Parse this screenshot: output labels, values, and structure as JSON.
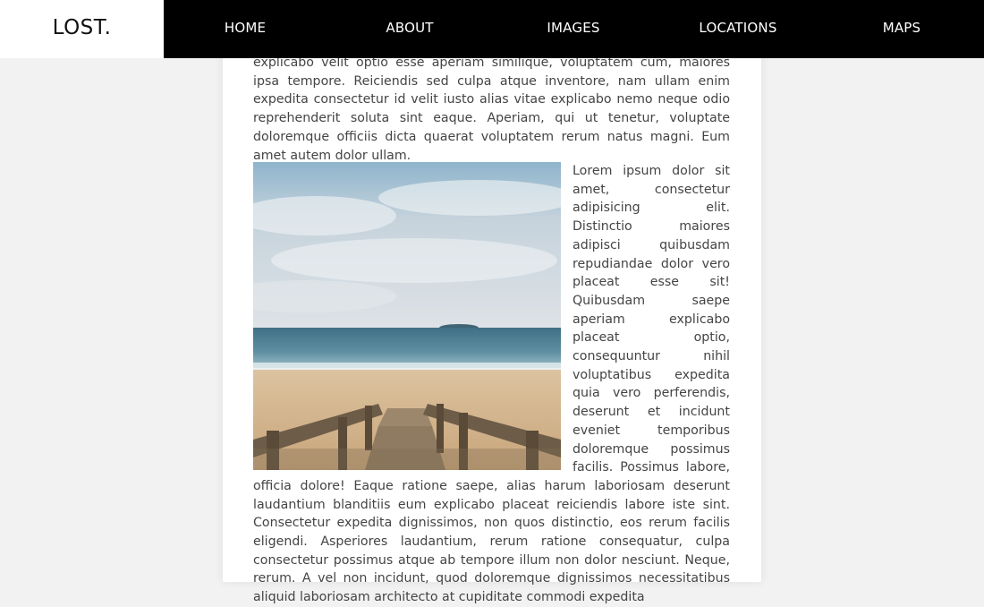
{
  "header": {
    "logo": "LOST.",
    "nav": [
      "HOME",
      "ABOUT",
      "IMAGES",
      "LOCATIONS",
      "MAPS"
    ]
  },
  "article": {
    "para1": "explicabo velit optio esse aperiam similique, voluptatem cum, maiores ipsa tempore. Reiciendis sed culpa atque inventore, nam ullam enim expedita consectetur id velit iusto alias vitae explicabo nemo neque odio reprehenderit soluta sint eaque. Aperiam, qui ut tenetur, voluptate doloremque officiis dicta quaerat voluptatem rerum natus magni. Eum amet autem dolor ullam.",
    "para2": "Lorem ipsum dolor sit amet, consectetur adipisicing elit. Distinctio maiores adipisci quibusdam repudiandae dolor vero placeat esse sit! Quibusdam saepe aperiam explicabo placeat optio, consequuntur nihil voluptatibus expedita quia vero perferendis, deserunt et incidunt eveniet temporibus doloremque possimus facilis. Possimus labore, officia dolore! Eaque ratione saepe, alias harum laboriosam deserunt laudantium blanditiis eum explicabo placeat reiciendis labore iste sint. Consectetur expedita dignissimos, non quos distinctio, eos rerum facilis eligendi. Asperiores laudantium, rerum ratione consequatur, culpa consectetur possimus atque ab tempore illum non dolor nesciunt. Neque, rerum. A vel non incidunt, quod doloremque dignissimos necessitatibus aliquid laboriosam architecto at cupiditate commodi expedita"
  },
  "colors": {
    "header_bg": "#000000",
    "logo_bg": "#ffffff",
    "page_bg": "#f2f2f2",
    "text": "#444444"
  }
}
